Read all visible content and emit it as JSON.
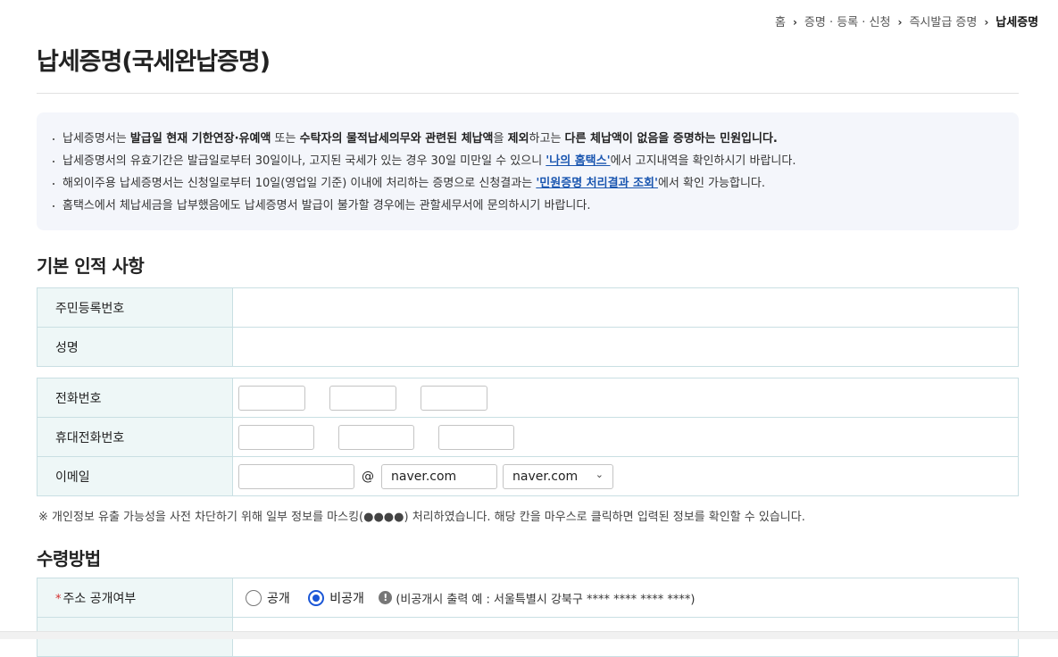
{
  "breadcrumb": {
    "items": [
      "홈",
      "증명 · 등록 · 신청",
      "즉시발급 증명",
      "납세증명"
    ],
    "separator": "›"
  },
  "page_title": "납세증명(국세완납증명)",
  "notice": {
    "line1": {
      "p1": "납세증명서는 ",
      "b1": "발급일 현재 기한연장·유예액",
      "p2": " 또는 ",
      "b2": "수탁자의 물적납세의무와 관련된 체납액",
      "p3": "을 ",
      "b3": "제외",
      "p4": "하고는 ",
      "b4": "다른 체납액이 없음을 증명하는 민원입니다."
    },
    "line2": {
      "p1": "납세증명서의 유효기간은 발급일로부터 30일이나, 고지된 국세가 있는 경우 30일 미만일 수 있으니 ",
      "link": "'나의 홈택스'",
      "p2": "에서 고지내역을 확인하시기 바랍니다."
    },
    "line3": {
      "p1": "해외이주용 납세증명서는 신청일로부터 10일(영업일 기준) 이내에 처리하는 증명으로 신청결과는 ",
      "link": "'민원증명 처리결과 조회'",
      "p2": "에서 확인 가능합니다."
    },
    "line4": "홈택스에서 체납세금을 납부했음에도 납세증명서 발급이 불가할 경우에는 관할세무서에 문의하시기 바랍니다."
  },
  "basic_info": {
    "section_title": "기본 인적 사항",
    "resident_number_label": "주민등록번호",
    "resident_number_value": "",
    "name_label": "성명",
    "name_value": "",
    "phone_label": "전화번호",
    "phone_values": [
      "",
      "",
      ""
    ],
    "mobile_label": "휴대전화번호",
    "mobile_values": [
      "",
      "",
      ""
    ],
    "email_label": "이메일",
    "email_id": "",
    "email_at": "@",
    "email_domain": "naver.com",
    "email_domain_select": "naver.com"
  },
  "masking_note": "※ 개인정보 유출 가능성을 사전 차단하기 위해 일부 정보를 마스킹(●●●●) 처리하였습니다. 해당 칸을 마우스로 클릭하면 입력된 정보를 확인할 수 있습니다.",
  "receipt": {
    "section_title": "수령방법",
    "address_public_label": "주소 공개여부",
    "required_mark": "*",
    "option_public": "공개",
    "option_private": "비공개",
    "selected": "비공개",
    "hint": "(비공개시 출력 예 : 서울특별시 강북구 **** **** **** ****)",
    "info_icon": "!"
  }
}
